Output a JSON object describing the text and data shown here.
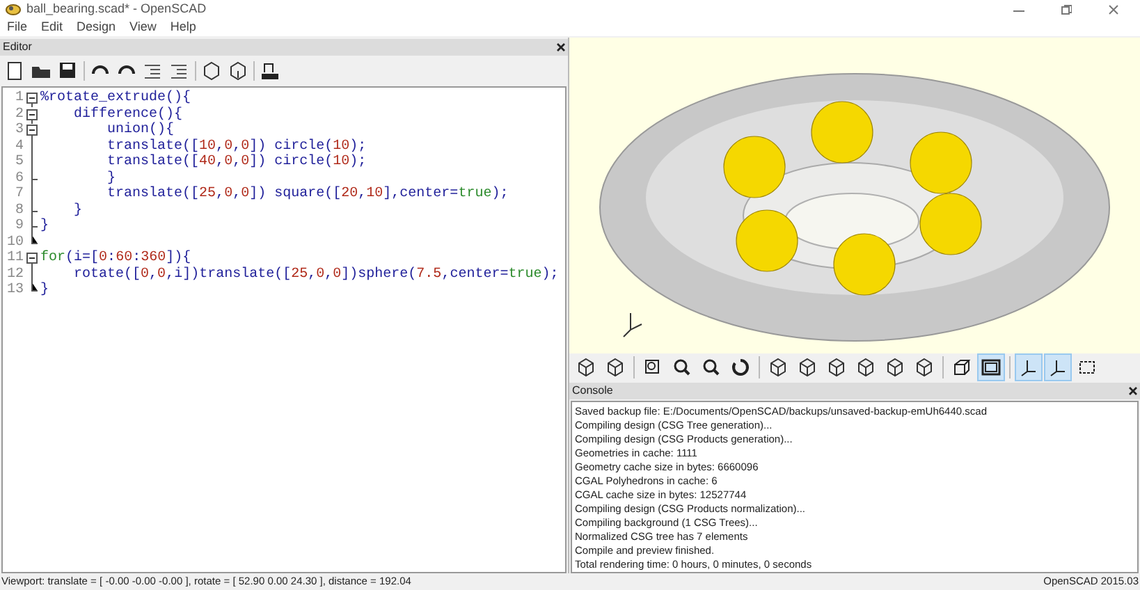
{
  "window": {
    "title": "ball_bearing.scad* - OpenSCAD"
  },
  "menu": [
    "File",
    "Edit",
    "Design",
    "View",
    "Help"
  ],
  "editor": {
    "title": "Editor",
    "lines": [
      {
        "number": "1",
        "kind": "open",
        "tokens": [
          {
            "kind": "plain",
            "text": "%rotate_extrude(){"
          }
        ]
      },
      {
        "number": "2",
        "kind": "open",
        "tokens": [
          {
            "kind": "plain",
            "text": "    difference(){"
          }
        ]
      },
      {
        "number": "3",
        "kind": "open",
        "tokens": [
          {
            "kind": "plain",
            "text": "        union(){"
          }
        ]
      },
      {
        "number": "4",
        "kind": "line",
        "tokens": [
          {
            "kind": "plain",
            "text": "        translate(["
          },
          {
            "kind": "number",
            "text": "10"
          },
          {
            "kind": "plain",
            "text": ","
          },
          {
            "kind": "number",
            "text": "0"
          },
          {
            "kind": "plain",
            "text": ","
          },
          {
            "kind": "number",
            "text": "0"
          },
          {
            "kind": "plain",
            "text": "]) circle("
          },
          {
            "kind": "number",
            "text": "10"
          },
          {
            "kind": "plain",
            "text": ");"
          }
        ]
      },
      {
        "number": "5",
        "kind": "line",
        "tokens": [
          {
            "kind": "plain",
            "text": "        translate(["
          },
          {
            "kind": "number",
            "text": "40"
          },
          {
            "kind": "plain",
            "text": ","
          },
          {
            "kind": "number",
            "text": "0"
          },
          {
            "kind": "plain",
            "text": ","
          },
          {
            "kind": "number",
            "text": "0"
          },
          {
            "kind": "plain",
            "text": "]) circle("
          },
          {
            "kind": "number",
            "text": "10"
          },
          {
            "kind": "plain",
            "text": ");"
          }
        ]
      },
      {
        "number": "6",
        "kind": "tick",
        "tokens": [
          {
            "kind": "plain",
            "text": "        }"
          }
        ]
      },
      {
        "number": "7",
        "kind": "line",
        "tokens": [
          {
            "kind": "plain",
            "text": "        translate(["
          },
          {
            "kind": "number",
            "text": "25"
          },
          {
            "kind": "plain",
            "text": ","
          },
          {
            "kind": "number",
            "text": "0"
          },
          {
            "kind": "plain",
            "text": ","
          },
          {
            "kind": "number",
            "text": "0"
          },
          {
            "kind": "plain",
            "text": "]) square(["
          },
          {
            "kind": "number",
            "text": "20"
          },
          {
            "kind": "plain",
            "text": ","
          },
          {
            "kind": "number",
            "text": "10"
          },
          {
            "kind": "plain",
            "text": "],center="
          },
          {
            "kind": "keyword",
            "text": "true"
          },
          {
            "kind": "plain",
            "text": ");"
          }
        ]
      },
      {
        "number": "8",
        "kind": "tick",
        "tokens": [
          {
            "kind": "plain",
            "text": "    }"
          }
        ]
      },
      {
        "number": "9",
        "kind": "tick",
        "tokens": [
          {
            "kind": "plain",
            "text": "}"
          }
        ]
      },
      {
        "number": "10",
        "kind": "end"
      },
      {
        "number": "11",
        "kind": "open",
        "tokens": [
          {
            "kind": "keyword",
            "text": "for"
          },
          {
            "kind": "plain",
            "text": "(i=["
          },
          {
            "kind": "number",
            "text": "0"
          },
          {
            "kind": "plain",
            "text": ":"
          },
          {
            "kind": "number",
            "text": "60"
          },
          {
            "kind": "plain",
            "text": ":"
          },
          {
            "kind": "number",
            "text": "360"
          },
          {
            "kind": "plain",
            "text": "]){"
          }
        ]
      },
      {
        "number": "12",
        "kind": "line",
        "tokens": [
          {
            "kind": "plain",
            "text": "    rotate(["
          },
          {
            "kind": "number",
            "text": "0"
          },
          {
            "kind": "plain",
            "text": ","
          },
          {
            "kind": "number",
            "text": "0"
          },
          {
            "kind": "plain",
            "text": ",i])translate(["
          },
          {
            "kind": "number",
            "text": "25"
          },
          {
            "kind": "plain",
            "text": ","
          },
          {
            "kind": "number",
            "text": "0"
          },
          {
            "kind": "plain",
            "text": ","
          },
          {
            "kind": "number",
            "text": "0"
          },
          {
            "kind": "plain",
            "text": "])sphere("
          },
          {
            "kind": "number",
            "text": "7.5"
          },
          {
            "kind": "plain",
            "text": ",center="
          },
          {
            "kind": "keyword",
            "text": "true"
          },
          {
            "kind": "plain",
            "text": ");"
          }
        ]
      },
      {
        "number": "13",
        "kind": "end",
        "tokens": [
          {
            "kind": "plain",
            "text": "}"
          }
        ]
      }
    ]
  },
  "view_toolbar": [
    {
      "selected": false
    },
    {
      "selected": false
    },
    {
      "selected": false
    },
    {
      "selected": false
    },
    {
      "selected": false
    },
    {
      "selected": false
    },
    {
      "selected": false
    },
    {
      "selected": false
    },
    {
      "selected": false
    },
    {
      "selected": false
    },
    {
      "selected": false
    },
    {
      "selected": false
    },
    {
      "selected": false
    },
    {
      "selected": true
    },
    {
      "selected": true
    },
    {
      "selected": true
    },
    {
      "selected": false
    }
  ],
  "console": {
    "title": "Console",
    "lines": [
      "Saved backup file: E:/Documents/OpenSCAD/backups/unsaved-backup-emUh6440.scad",
      "Compiling design (CSG Tree generation)...",
      "Compiling design (CSG Products generation)...",
      "Geometries in cache: 1111",
      "Geometry cache size in bytes: 6660096",
      "CGAL Polyhedrons in cache: 6",
      "CGAL cache size in bytes: 12527744",
      "Compiling design (CSG Products normalization)...",
      "Compiling background (1 CSG Trees)...",
      "Normalized CSG tree has 7 elements",
      "Compile and preview finished.",
      "Total rendering time: 0 hours, 0 minutes, 0 seconds"
    ]
  },
  "status_bar": {
    "viewport": "Viewport: translate = [ -0.00 -0.00 -0.00 ], rotate = [ 52.90 0.00 24.30 ], distance = 192.04",
    "version": "OpenSCAD 2015.03"
  }
}
